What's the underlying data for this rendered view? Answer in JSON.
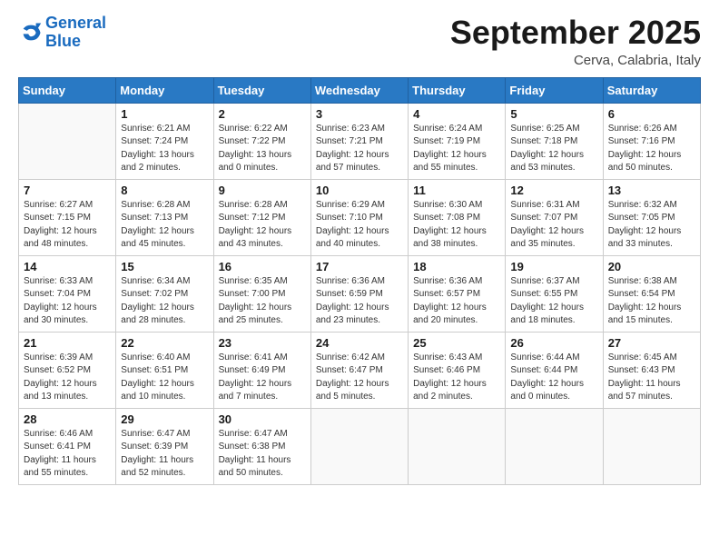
{
  "header": {
    "logo_general": "General",
    "logo_blue": "Blue",
    "month_title": "September 2025",
    "location": "Cerva, Calabria, Italy"
  },
  "days_of_week": [
    "Sunday",
    "Monday",
    "Tuesday",
    "Wednesday",
    "Thursday",
    "Friday",
    "Saturday"
  ],
  "weeks": [
    [
      {
        "day": "",
        "info": ""
      },
      {
        "day": "1",
        "info": "Sunrise: 6:21 AM\nSunset: 7:24 PM\nDaylight: 13 hours\nand 2 minutes."
      },
      {
        "day": "2",
        "info": "Sunrise: 6:22 AM\nSunset: 7:22 PM\nDaylight: 13 hours\nand 0 minutes."
      },
      {
        "day": "3",
        "info": "Sunrise: 6:23 AM\nSunset: 7:21 PM\nDaylight: 12 hours\nand 57 minutes."
      },
      {
        "day": "4",
        "info": "Sunrise: 6:24 AM\nSunset: 7:19 PM\nDaylight: 12 hours\nand 55 minutes."
      },
      {
        "day": "5",
        "info": "Sunrise: 6:25 AM\nSunset: 7:18 PM\nDaylight: 12 hours\nand 53 minutes."
      },
      {
        "day": "6",
        "info": "Sunrise: 6:26 AM\nSunset: 7:16 PM\nDaylight: 12 hours\nand 50 minutes."
      }
    ],
    [
      {
        "day": "7",
        "info": "Sunrise: 6:27 AM\nSunset: 7:15 PM\nDaylight: 12 hours\nand 48 minutes."
      },
      {
        "day": "8",
        "info": "Sunrise: 6:28 AM\nSunset: 7:13 PM\nDaylight: 12 hours\nand 45 minutes."
      },
      {
        "day": "9",
        "info": "Sunrise: 6:28 AM\nSunset: 7:12 PM\nDaylight: 12 hours\nand 43 minutes."
      },
      {
        "day": "10",
        "info": "Sunrise: 6:29 AM\nSunset: 7:10 PM\nDaylight: 12 hours\nand 40 minutes."
      },
      {
        "day": "11",
        "info": "Sunrise: 6:30 AM\nSunset: 7:08 PM\nDaylight: 12 hours\nand 38 minutes."
      },
      {
        "day": "12",
        "info": "Sunrise: 6:31 AM\nSunset: 7:07 PM\nDaylight: 12 hours\nand 35 minutes."
      },
      {
        "day": "13",
        "info": "Sunrise: 6:32 AM\nSunset: 7:05 PM\nDaylight: 12 hours\nand 33 minutes."
      }
    ],
    [
      {
        "day": "14",
        "info": "Sunrise: 6:33 AM\nSunset: 7:04 PM\nDaylight: 12 hours\nand 30 minutes."
      },
      {
        "day": "15",
        "info": "Sunrise: 6:34 AM\nSunset: 7:02 PM\nDaylight: 12 hours\nand 28 minutes."
      },
      {
        "day": "16",
        "info": "Sunrise: 6:35 AM\nSunset: 7:00 PM\nDaylight: 12 hours\nand 25 minutes."
      },
      {
        "day": "17",
        "info": "Sunrise: 6:36 AM\nSunset: 6:59 PM\nDaylight: 12 hours\nand 23 minutes."
      },
      {
        "day": "18",
        "info": "Sunrise: 6:36 AM\nSunset: 6:57 PM\nDaylight: 12 hours\nand 20 minutes."
      },
      {
        "day": "19",
        "info": "Sunrise: 6:37 AM\nSunset: 6:55 PM\nDaylight: 12 hours\nand 18 minutes."
      },
      {
        "day": "20",
        "info": "Sunrise: 6:38 AM\nSunset: 6:54 PM\nDaylight: 12 hours\nand 15 minutes."
      }
    ],
    [
      {
        "day": "21",
        "info": "Sunrise: 6:39 AM\nSunset: 6:52 PM\nDaylight: 12 hours\nand 13 minutes."
      },
      {
        "day": "22",
        "info": "Sunrise: 6:40 AM\nSunset: 6:51 PM\nDaylight: 12 hours\nand 10 minutes."
      },
      {
        "day": "23",
        "info": "Sunrise: 6:41 AM\nSunset: 6:49 PM\nDaylight: 12 hours\nand 7 minutes."
      },
      {
        "day": "24",
        "info": "Sunrise: 6:42 AM\nSunset: 6:47 PM\nDaylight: 12 hours\nand 5 minutes."
      },
      {
        "day": "25",
        "info": "Sunrise: 6:43 AM\nSunset: 6:46 PM\nDaylight: 12 hours\nand 2 minutes."
      },
      {
        "day": "26",
        "info": "Sunrise: 6:44 AM\nSunset: 6:44 PM\nDaylight: 12 hours\nand 0 minutes."
      },
      {
        "day": "27",
        "info": "Sunrise: 6:45 AM\nSunset: 6:43 PM\nDaylight: 11 hours\nand 57 minutes."
      }
    ],
    [
      {
        "day": "28",
        "info": "Sunrise: 6:46 AM\nSunset: 6:41 PM\nDaylight: 11 hours\nand 55 minutes."
      },
      {
        "day": "29",
        "info": "Sunrise: 6:47 AM\nSunset: 6:39 PM\nDaylight: 11 hours\nand 52 minutes."
      },
      {
        "day": "30",
        "info": "Sunrise: 6:47 AM\nSunset: 6:38 PM\nDaylight: 11 hours\nand 50 minutes."
      },
      {
        "day": "",
        "info": ""
      },
      {
        "day": "",
        "info": ""
      },
      {
        "day": "",
        "info": ""
      },
      {
        "day": "",
        "info": ""
      }
    ]
  ]
}
